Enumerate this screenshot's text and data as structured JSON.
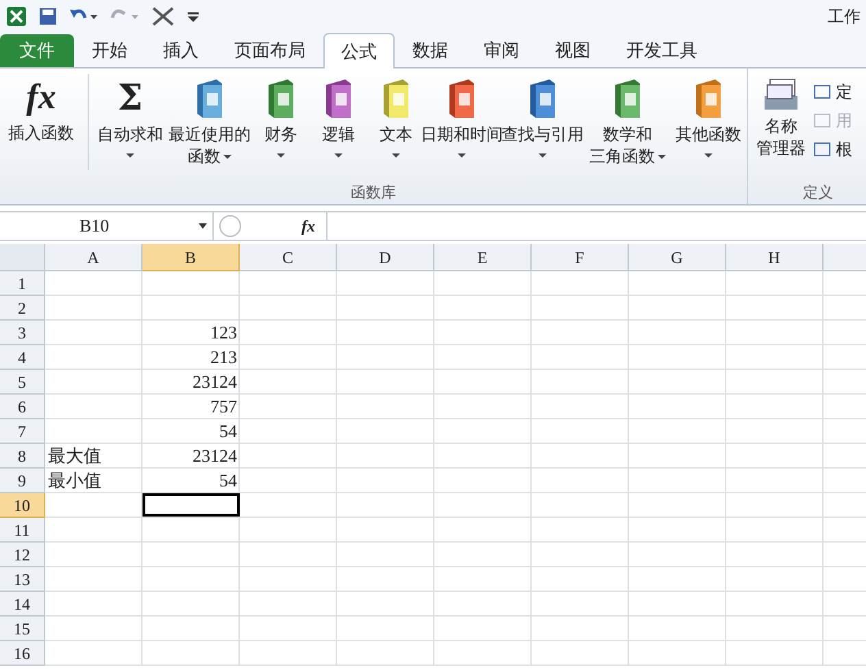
{
  "window": {
    "title": "工作"
  },
  "tabs": [
    {
      "label": "文件",
      "kind": "file",
      "selected": false
    },
    {
      "label": "开始",
      "kind": "tab",
      "selected": false
    },
    {
      "label": "插入",
      "kind": "tab",
      "selected": false
    },
    {
      "label": "页面布局",
      "kind": "tab",
      "selected": false
    },
    {
      "label": "公式",
      "kind": "tab",
      "selected": true
    },
    {
      "label": "数据",
      "kind": "tab",
      "selected": false
    },
    {
      "label": "审阅",
      "kind": "tab",
      "selected": false
    },
    {
      "label": "视图",
      "kind": "tab",
      "selected": false
    },
    {
      "label": "开发工具",
      "kind": "tab",
      "selected": false
    }
  ],
  "ribbon": {
    "function_library": {
      "glyph": "fx",
      "label": "插入函数",
      "buttons": [
        {
          "glyph": "Σ",
          "lines": [
            "自动求和"
          ],
          "dropdown": true
        },
        {
          "lines": [
            "最近使用的",
            "函数"
          ],
          "dropdown": true
        },
        {
          "lines": [
            "财务"
          ],
          "dropdown": true
        },
        {
          "lines": [
            "逻辑"
          ],
          "dropdown": true
        },
        {
          "lines": [
            "文本"
          ],
          "dropdown": true
        },
        {
          "lines": [
            "日期和时间"
          ],
          "dropdown": true
        },
        {
          "lines": [
            "查找与引用"
          ],
          "dropdown": true
        },
        {
          "lines": [
            "数学和",
            "三角函数"
          ],
          "dropdown": true
        },
        {
          "lines": [
            "其他函数"
          ],
          "dropdown": true
        }
      ],
      "group_label": "函数库"
    },
    "defined_names": {
      "name_manager": [
        "名称",
        "管理器"
      ],
      "small_items": [
        {
          "label": "定",
          "disabled": false
        },
        {
          "label": "用",
          "disabled": true
        },
        {
          "label": "根",
          "disabled": false
        }
      ],
      "group_label": "定义"
    }
  },
  "formula_bar": {
    "name_box": "B10",
    "fx": "fx"
  },
  "grid": {
    "columns": [
      {
        "label": "A",
        "selected": false
      },
      {
        "label": "B",
        "selected": true
      },
      {
        "label": "C",
        "selected": false
      },
      {
        "label": "D",
        "selected": false
      },
      {
        "label": "E",
        "selected": false
      },
      {
        "label": "F",
        "selected": false
      },
      {
        "label": "G",
        "selected": false
      },
      {
        "label": "H",
        "selected": false
      }
    ],
    "rows": [
      {
        "header": "1",
        "selected": false
      },
      {
        "header": "2",
        "selected": false
      },
      {
        "header": "3",
        "selected": false,
        "b": "123"
      },
      {
        "header": "4",
        "selected": false,
        "b": "213"
      },
      {
        "header": "5",
        "selected": false,
        "b": "23124"
      },
      {
        "header": "6",
        "selected": false,
        "b": "757"
      },
      {
        "header": "7",
        "selected": false,
        "b": "54"
      },
      {
        "header": "8",
        "selected": false,
        "a": "最大值",
        "b": "23124"
      },
      {
        "header": "9",
        "selected": false,
        "a": "最小值",
        "b": "54"
      },
      {
        "header": "10",
        "selected": true,
        "active_b": true
      },
      {
        "header": "11",
        "selected": false
      },
      {
        "header": "12",
        "selected": false
      },
      {
        "header": "13",
        "selected": false
      },
      {
        "header": "14",
        "selected": false
      },
      {
        "header": "15",
        "selected": false
      },
      {
        "header": "16",
        "selected": false
      }
    ]
  }
}
